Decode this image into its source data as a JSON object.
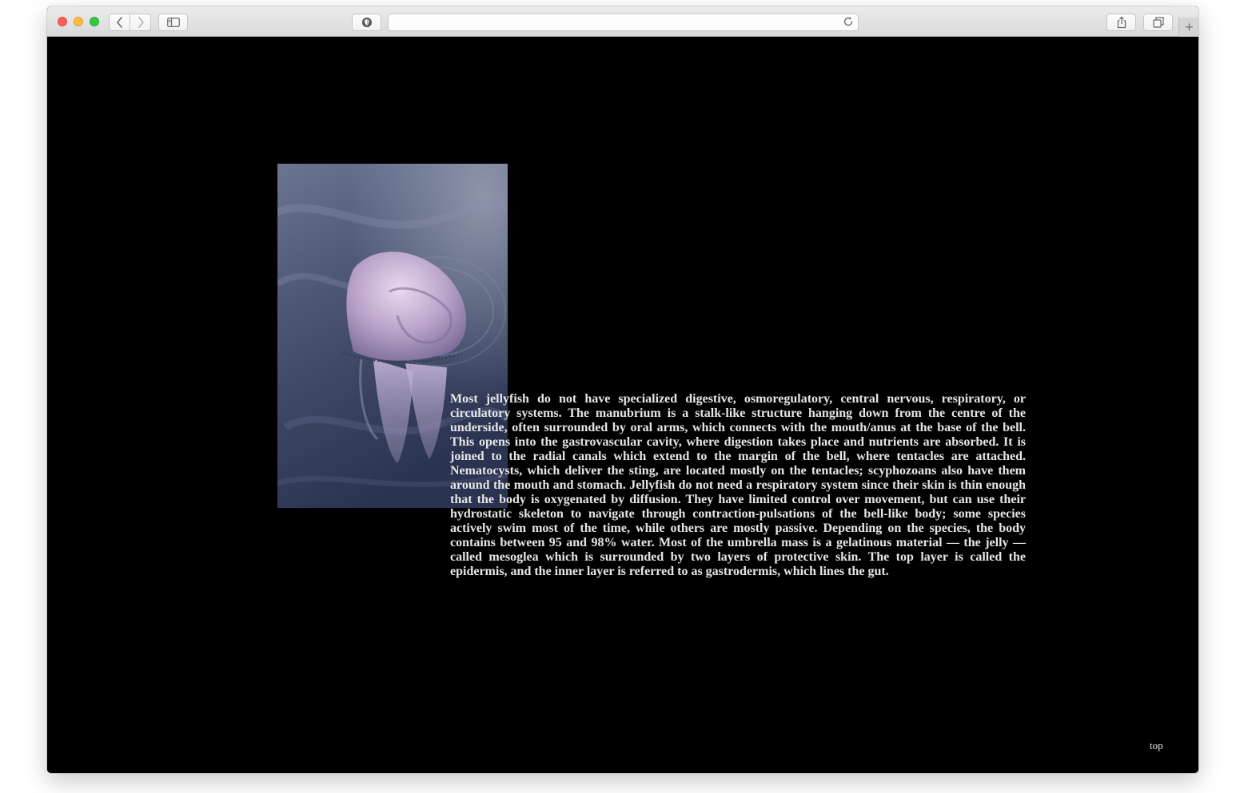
{
  "browser": {
    "address_value": "",
    "icons": [
      "close-light",
      "minimize-light",
      "zoom-light",
      "chevron-left-icon",
      "chevron-right-icon",
      "sidebar-icon",
      "privacy-shield-icon",
      "reload-icon",
      "share-icon",
      "tabs-icon",
      "plus-icon"
    ],
    "new_tab_label": "+"
  },
  "page": {
    "background": "#000000",
    "text_color": "#e6e6e6",
    "image_subject": "jellyfish",
    "body_text": "Most jellyfish do not have specialized digestive, osmoregulatory, central nervous, respiratory, or circulatory systems. The manubrium is a stalk-like structure hanging down from the centre of the underside, often surrounded by oral arms, which connects with the mouth/anus at the base of the bell. This opens into the gastrovascular cavity, where digestion takes place and nutrients are absorbed. It is joined to the radial canals which extend to the margin of the bell, where tentacles are attached. Nematocysts, which deliver the sting, are located mostly on the tentacles; scyphozoans also have them around the mouth and stomach. Jellyfish do not need a respiratory system since their skin is thin enough that the body is oxygenated by diffusion. They have limited control over movement, but can use their hydrostatic skeleton to navigate through contraction-pulsations of the bell-like body; some species actively swim most of the time, while others are mostly passive. Depending on the species, the body contains between 95 and 98% water. Most of the umbrella mass is a gelatinous material — the jelly — called mesoglea which is surrounded by two layers of protective skin. The top layer is called the epidermis, and the inner layer is referred to as gastrodermis, which lines the gut.",
    "top_link": "top"
  }
}
